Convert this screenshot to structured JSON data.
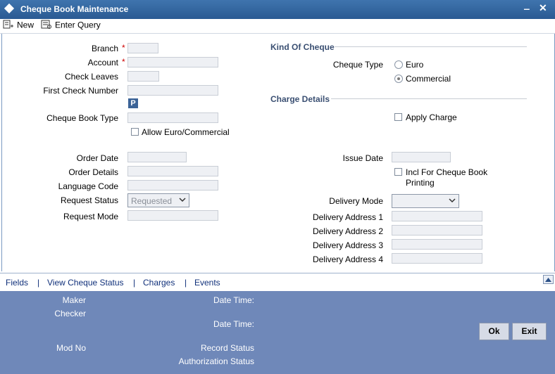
{
  "window": {
    "title": "Cheque Book Maintenance",
    "minimize": "‒",
    "close": "✕"
  },
  "toolbar": {
    "new_label": "New",
    "enter_query_label": "Enter Query"
  },
  "form": {
    "branch_label": "Branch",
    "account_label": "Account",
    "required_marker": "*",
    "check_leaves_label": "Check Leaves",
    "first_check_label": "First Check Number",
    "p_button": "P",
    "cheque_book_type_label": "Cheque Book Type",
    "allow_euro_label": "Allow Euro/Commercial",
    "order_date_label": "Order Date",
    "order_details_label": "Order Details",
    "language_code_label": "Language Code",
    "request_status_label": "Request Status",
    "request_status_value": "Requested",
    "request_mode_label": "Request Mode",
    "kind_of_cheque_section": "Kind Of Cheque",
    "cheque_type_label": "Cheque Type",
    "cheque_type_options": [
      "Euro",
      "Commercial"
    ],
    "cheque_type_selected": "Commercial",
    "charge_details_section": "Charge Details",
    "apply_charge_label": "Apply Charge",
    "issue_date_label": "Issue Date",
    "incl_cheque_book_label_1": "Incl For Cheque Book",
    "incl_cheque_book_label_2": "Printing",
    "delivery_mode_label": "Delivery Mode",
    "delivery_mode_value": "",
    "delivery_address_labels": [
      "Delivery Address 1",
      "Delivery Address 2",
      "Delivery Address 3",
      "Delivery Address 4"
    ]
  },
  "links": [
    "Fields",
    "View Cheque Status",
    "Charges",
    "Events"
  ],
  "link_separator": "|",
  "audit": {
    "maker_label": "Maker",
    "checker_label": "Checker",
    "date_time_label": "Date Time:",
    "mod_no_label": "Mod No",
    "record_status_label": "Record Status",
    "authorization_status_label": "Authorization Status"
  },
  "buttons": {
    "ok": "Ok",
    "exit": "Exit"
  },
  "colors": {
    "title_bar": "#2f639e",
    "audit_panel": "#6f88b9",
    "link_text": "#10307a"
  }
}
